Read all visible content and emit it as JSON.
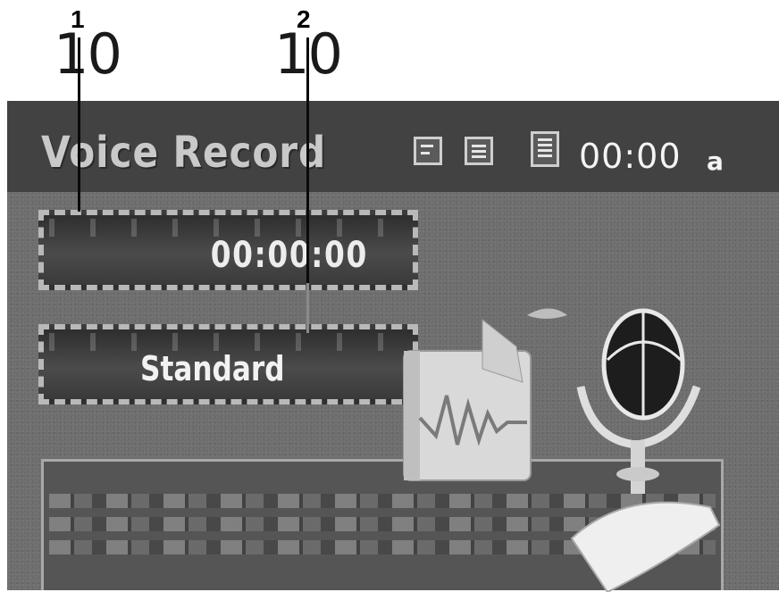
{
  "callouts": [
    {
      "number": "1"
    },
    {
      "number": "2"
    }
  ],
  "ghost_top": {
    "left": "10",
    "middle": "10"
  },
  "header": {
    "title": "Voice Record",
    "clock": "00:00",
    "clock_suffix": "a",
    "icons": [
      "battery-icon",
      "memo-icon",
      "list-icon"
    ]
  },
  "recording": {
    "elapsed_time": "00:00:00",
    "quality_mode": "Standard"
  },
  "colors": {
    "screen_bg": "#6e6e6e",
    "header_bg": "#424242",
    "text": "#f2f2f2"
  }
}
